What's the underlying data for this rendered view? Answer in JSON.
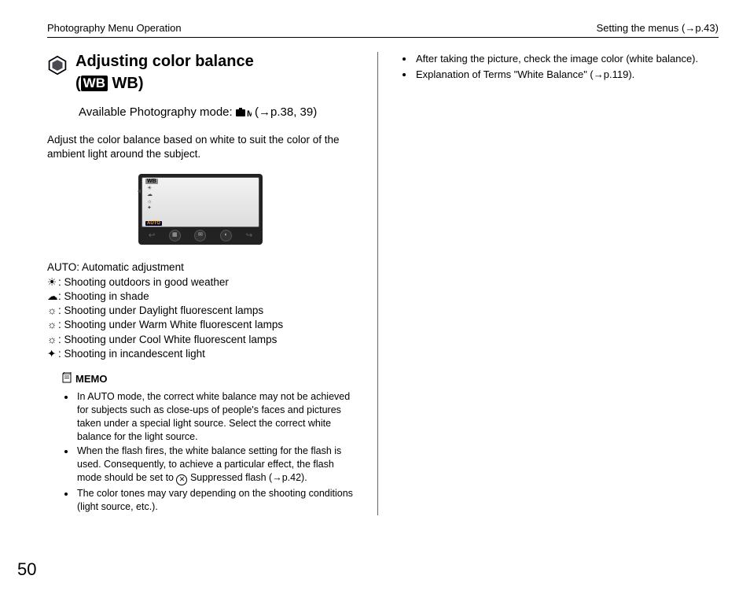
{
  "header": {
    "left": "Photography Menu Operation",
    "right_prefix": "Setting the menus (",
    "right_ref": "p.43",
    "right_suffix": ")"
  },
  "title": {
    "line1": "Adjusting color balance",
    "line2_open": "(",
    "line2_badge": "WB",
    "line2_close": " WB)"
  },
  "subhead": {
    "prefix": "Available Photography mode: ",
    "suffix_open": " (",
    "ref": "p.38, 39",
    "suffix_close": ")"
  },
  "intro": "Adjust the color balance based on white to suit the color of the ambient light around the subject.",
  "lcd": {
    "wb": "WB",
    "auto": "AUTO"
  },
  "defs": {
    "auto": "AUTO: Automatic adjustment",
    "sun": ": Shooting outdoors in good weather",
    "shade": ": Shooting in shade",
    "fl1": ": Shooting under Daylight fluorescent lamps",
    "fl2": ": Shooting under Warm White fluorescent lamps",
    "fl3": ": Shooting under Cool White fluorescent lamps",
    "inc": ": Shooting in incandescent light"
  },
  "memo": {
    "heading": "MEMO",
    "items": [
      "In AUTO mode, the correct white balance may not be achieved for subjects such as close-ups of people's faces and pictures taken under a special light source. Select the correct white balance for the light source.",
      "When the flash fires, the white balance setting for the flash is used. Consequently, to achieve a particular effect, the flash mode should be set to ",
      " Suppressed flash (",
      "p.42",
      ").",
      "The color tones may vary depending on the shooting conditions (light source, etc.)."
    ]
  },
  "right": {
    "item1": "After taking the picture, check the image color (white balance).",
    "item2_prefix": "Explanation of Terms \"White Balance\" (",
    "item2_ref": "p.119",
    "item2_suffix": ")."
  },
  "page_number": "50"
}
